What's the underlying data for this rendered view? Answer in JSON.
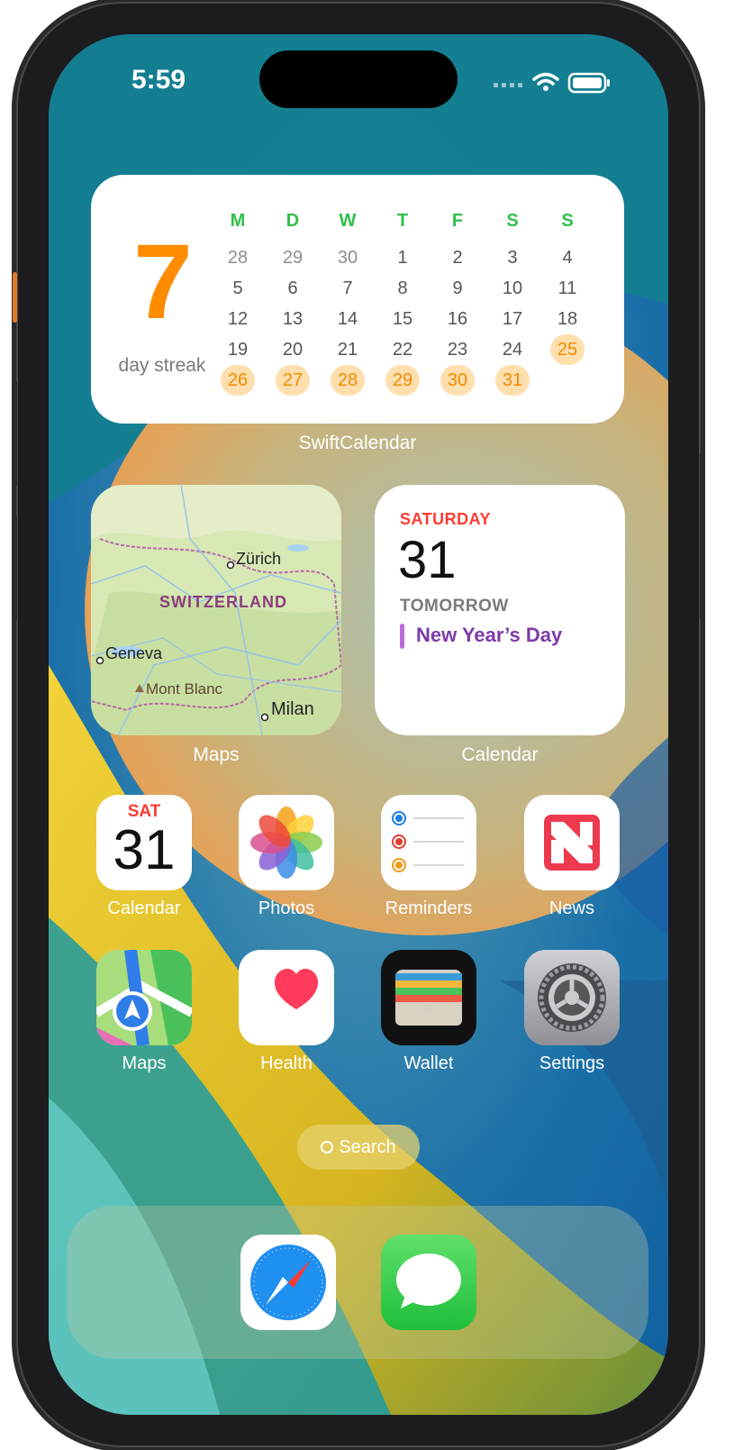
{
  "status": {
    "time": "5:59"
  },
  "streak_widget": {
    "number": "7",
    "label": "day streak",
    "app_label": "SwiftCalendar",
    "weekdays": [
      "M",
      "D",
      "W",
      "T",
      "F",
      "S",
      "S"
    ],
    "rows": [
      [
        "28",
        "29",
        "30",
        "1",
        "2",
        "3",
        "4"
      ],
      [
        "5",
        "6",
        "7",
        "8",
        "9",
        "10",
        "11"
      ],
      [
        "12",
        "13",
        "14",
        "15",
        "16",
        "17",
        "18"
      ],
      [
        "19",
        "20",
        "21",
        "22",
        "23",
        "24",
        "25"
      ],
      [
        "26",
        "27",
        "28",
        "29",
        "30",
        "31",
        ""
      ]
    ]
  },
  "maps_widget": {
    "app_label": "Maps",
    "places": {
      "zurich": "Zürich",
      "switzerland": "SWITZERLAND",
      "geneva": "Geneva",
      "mont_blanc": "Mont Blanc",
      "milan": "Milan"
    }
  },
  "calendar_widget": {
    "app_label": "Calendar",
    "day": "SATURDAY",
    "date": "31",
    "tomorrow": "TOMORROW",
    "event": "New Year’s Day"
  },
  "apps": [
    {
      "label": "Calendar",
      "day": "SAT",
      "date": "31"
    },
    {
      "label": "Photos"
    },
    {
      "label": "Reminders"
    },
    {
      "label": "News"
    },
    {
      "label": "Maps"
    },
    {
      "label": "Health"
    },
    {
      "label": "Wallet"
    },
    {
      "label": "Settings"
    }
  ],
  "search": {
    "label": "Search"
  },
  "colors": {
    "accent_streak": "#ff8c00",
    "weekday_green": "#2fbf4a",
    "event_purple": "#7e3aa8",
    "saturday_red": "#ff3b30"
  }
}
